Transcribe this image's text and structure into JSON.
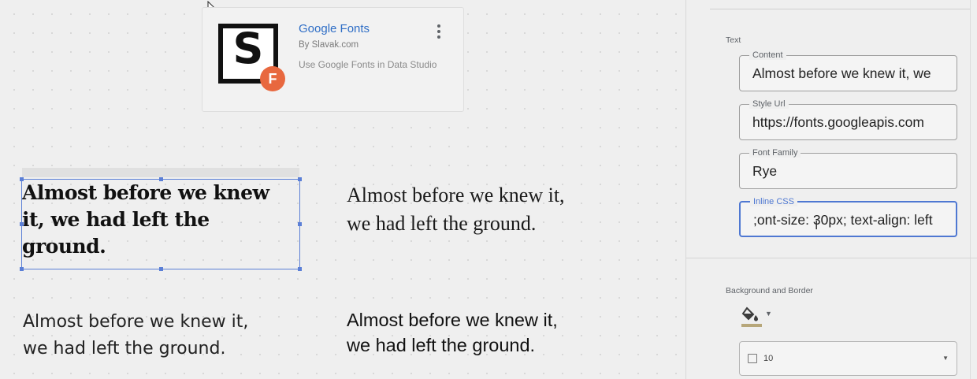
{
  "connector_card": {
    "logo_letter": "S",
    "badge_letter": "F",
    "title": "Google Fonts",
    "author": "By Slavak.com",
    "description": "Use Google Fonts in Data Studio",
    "menu_icon": "more-vert-icon"
  },
  "samples": [
    {
      "line1": "Almost before we knew",
      "line2": "it, we had left the",
      "line3": "ground."
    },
    {
      "line1": "Almost before we knew it,",
      "line2": "we had left the ground."
    },
    {
      "line1": "Almost before we knew it,",
      "line2": "we had left the ground."
    },
    {
      "line1": "Almost before we knew it,",
      "line2": "we had left the ground."
    }
  ],
  "panel": {
    "text_section_label": "Text",
    "fields": {
      "content": {
        "label": "Content",
        "value": "Almost before we knew it, we"
      },
      "style_url": {
        "label": "Style Url",
        "value": "https://fonts.googleapis.com"
      },
      "font_family": {
        "label": "Font Family",
        "value": "Rye"
      },
      "inline_css": {
        "label": "Inline CSS",
        "value": "ont-size: 30px; text-align: left;"
      }
    },
    "background_section_label": "Background and Border",
    "fill_icon": "fill-color-icon",
    "border_select_value": "10"
  },
  "colors": {
    "accent": "#4f78d2",
    "link": "#2f6ec6",
    "badge": "#e8683f"
  }
}
